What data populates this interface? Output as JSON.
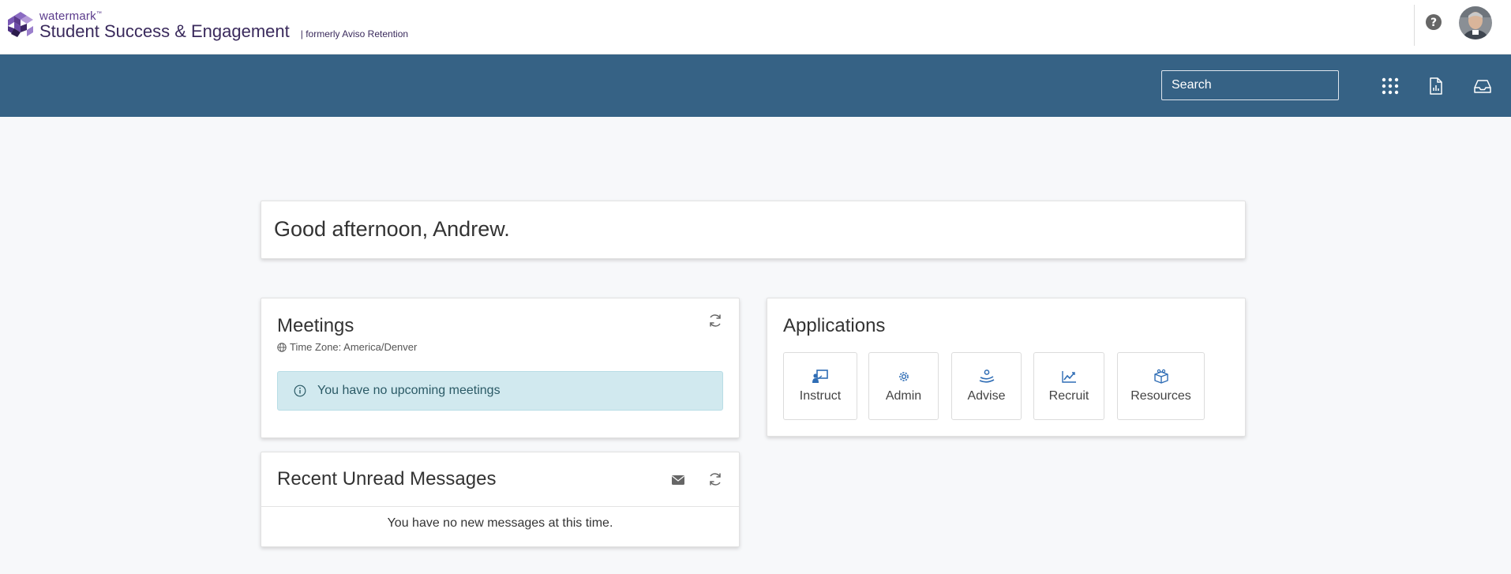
{
  "header": {
    "brand": "watermark",
    "brand_tm": "™",
    "product": "Student Success & Engagement",
    "formerly": "| formerly Aviso Retention"
  },
  "navbar": {
    "search_placeholder": "Search",
    "icons": [
      "apps-grid-icon",
      "report-icon",
      "inbox-icon"
    ]
  },
  "greeting": {
    "text": "Good afternoon, Andrew."
  },
  "meetings": {
    "title": "Meetings",
    "timezone": "Time Zone: America/Denver",
    "empty_text": "You have no upcoming meetings"
  },
  "messages": {
    "title": "Recent Unread Messages",
    "empty_text": "You have no new messages at this time."
  },
  "applications": {
    "title": "Applications",
    "items": [
      {
        "label": "Instruct",
        "icon": "instruct-icon"
      },
      {
        "label": "Admin",
        "icon": "admin-gear-icon"
      },
      {
        "label": "Advise",
        "icon": "advise-icon"
      },
      {
        "label": "Recruit",
        "icon": "recruit-chart-icon"
      },
      {
        "label": "Resources",
        "icon": "resources-box-icon"
      }
    ]
  },
  "colors": {
    "navbar": "#366285",
    "brand_purple": "#5b3b8c",
    "alert_bg": "#d1e9ef",
    "app_icon_blue": "#2f6db5"
  }
}
